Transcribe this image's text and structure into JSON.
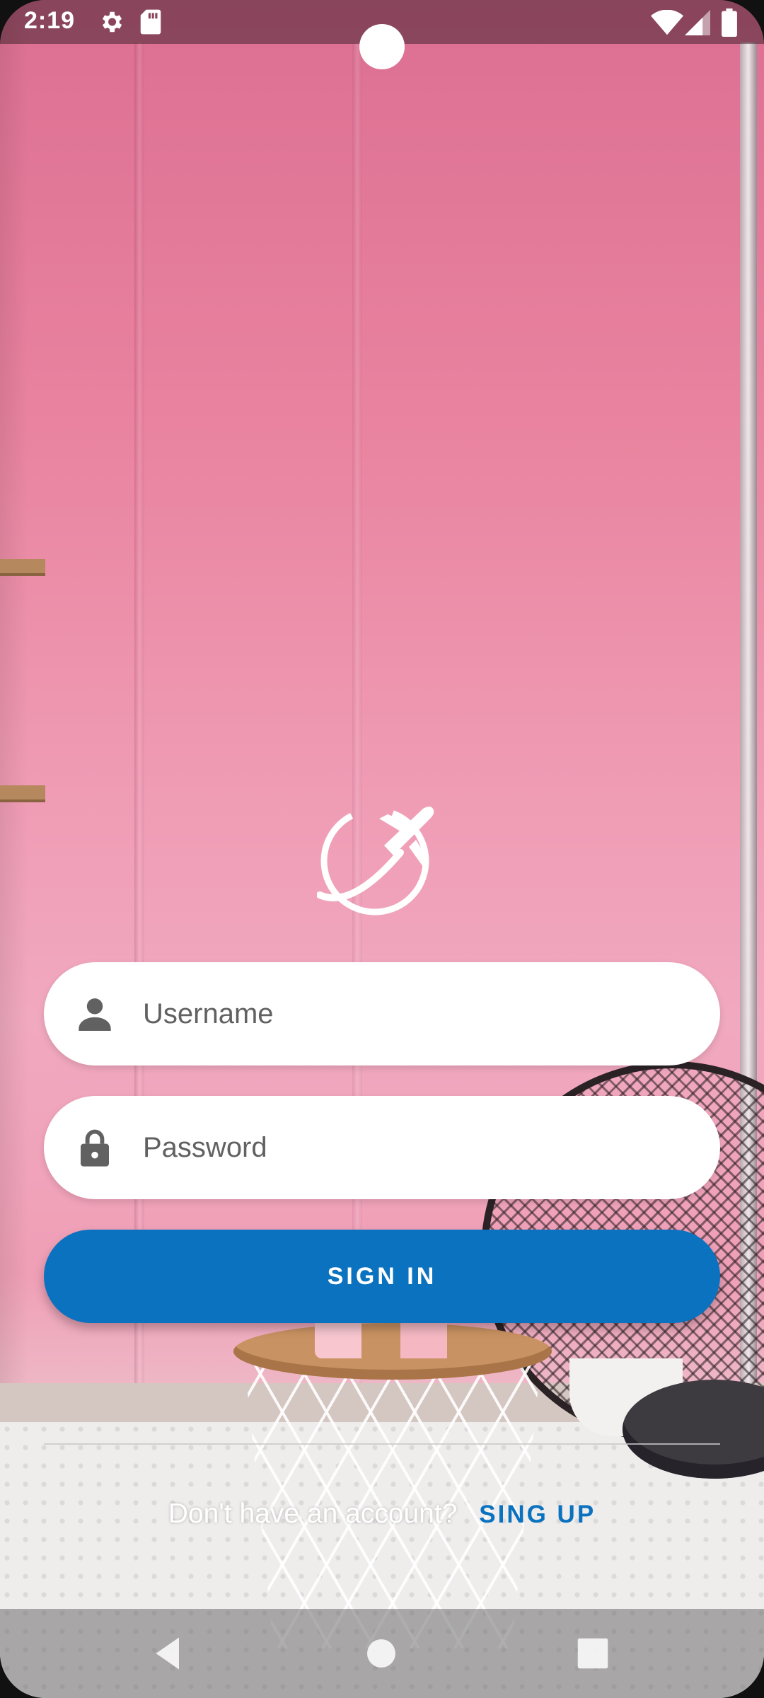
{
  "status_bar": {
    "time": "2:19",
    "icons": [
      "settings-icon",
      "sd-card-icon",
      "wifi-icon",
      "signal-icon",
      "battery-icon"
    ]
  },
  "login": {
    "logo_icon": "globe-airplane-logo-icon",
    "username_placeholder": "Username",
    "password_placeholder": "Password",
    "signin_label": "SIGN IN",
    "signup_prompt": "Don't have an account?",
    "signup_label": "SING UP"
  },
  "colors": {
    "accent": "#0a72bf",
    "field_bg": "#ffffff",
    "wall": "#ef9ab3"
  },
  "nav_bar": {
    "buttons": [
      "back-icon",
      "home-icon",
      "recent-apps-icon"
    ]
  }
}
